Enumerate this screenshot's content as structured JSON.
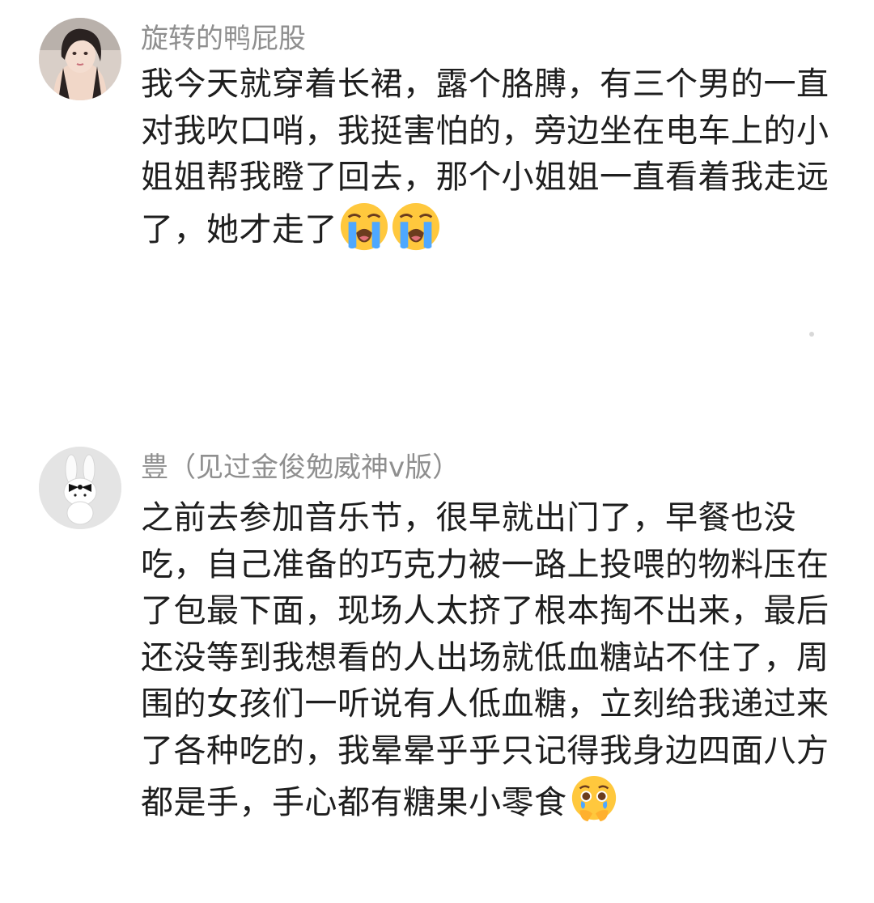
{
  "comments": [
    {
      "username": "旋转的鸭屁股",
      "avatar_icon": "user-avatar-photo",
      "text": "我今天就穿着长裙，露个胳膊，有三个男的一直对我吹口哨，我挺害怕的，旁边坐在电车上的小姐姐帮我瞪了回去，那个小姐姐一直看着我走远了，她才走了",
      "emojis": [
        "loudly-crying-face-icon",
        "loudly-crying-face-icon"
      ]
    },
    {
      "username": "豊（见过金俊勉威神v版）",
      "avatar_icon": "white-bunny-avatar",
      "text": "之前去参加音乐节，很早就出门了，早餐也没吃，自己准备的巧克力被一路上投喂的物料压在了包最下面，现场人太挤了根本掏不出来，最后还没等到我想看的人出场就低血糖站不住了，周围的女孩们一听说有人低血糖，立刻给我递过来了各种吃的，我晕晕乎乎只记得我身边四面八方都是手，手心都有糖果小零食",
      "emojis": [
        "face-holding-back-tears-icon"
      ]
    }
  ],
  "colors": {
    "background": "#ffffff",
    "username": "#8f8f8f",
    "text": "#1e1e1e",
    "emoji_yellow": "#ffc83d",
    "emoji_tears": "#4ea8ff"
  }
}
